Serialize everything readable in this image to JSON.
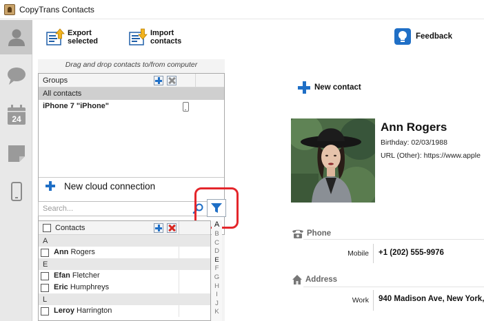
{
  "window": {
    "title": "CopyTrans Contacts"
  },
  "sidebar": {
    "items": [
      {
        "icon": "person-icon",
        "active": true
      },
      {
        "icon": "chat-bubble-icon",
        "active": false
      },
      {
        "icon": "calendar-icon",
        "label": "24",
        "active": false
      },
      {
        "icon": "note-icon",
        "active": false
      },
      {
        "icon": "phone-icon",
        "active": false
      }
    ]
  },
  "toolbar": {
    "export_label": "Export\nselected",
    "import_label": "Import\ncontacts",
    "feedback_label": "Feedback"
  },
  "left_panel": {
    "dnd_hint": "Drag and drop contacts to/from computer",
    "groups_header": "Groups",
    "groups": [
      {
        "label": "All contacts",
        "selected": true
      },
      {
        "label": "iPhone 7 \"iPhone\"",
        "selected": false,
        "device": true
      }
    ],
    "new_cloud_label": "New cloud connection",
    "search_placeholder": "Search...",
    "contacts_header": "Contacts",
    "contact_rows": [
      {
        "type": "section",
        "text": "A"
      },
      {
        "type": "contact",
        "first": "Ann",
        "last": "Rogers"
      },
      {
        "type": "section",
        "text": "E"
      },
      {
        "type": "contact",
        "first": "Efan",
        "last": "Fletcher"
      },
      {
        "type": "contact",
        "first": "Eric",
        "last": "Humphreys"
      },
      {
        "type": "section",
        "text": "L"
      },
      {
        "type": "contact",
        "first": "Leroy",
        "last": "Harrington"
      }
    ],
    "alphabet": [
      "A",
      "B",
      "C",
      "D",
      "E",
      "F",
      "G",
      "H",
      "I",
      "J",
      "K"
    ],
    "alphabet_available": [
      "A",
      "E"
    ]
  },
  "right_panel": {
    "new_contact_label": "New contact",
    "contact": {
      "name": "Ann Rogers",
      "birthday": "Birthday: 02/03/1988",
      "url": "URL (Other): https://www.apple"
    },
    "phone_section": {
      "title": "Phone",
      "label": "Mobile",
      "value": "+1 (202) 555-9976"
    },
    "address_section": {
      "title": "Address",
      "label": "Work",
      "value": "940 Madison Ave, New York,"
    }
  },
  "colors": {
    "accent_blue": "#1f6fc6",
    "highlight_red": "#e4262b",
    "delete_red": "#d8271f",
    "sidebar_bg": "#e8e8e8"
  }
}
